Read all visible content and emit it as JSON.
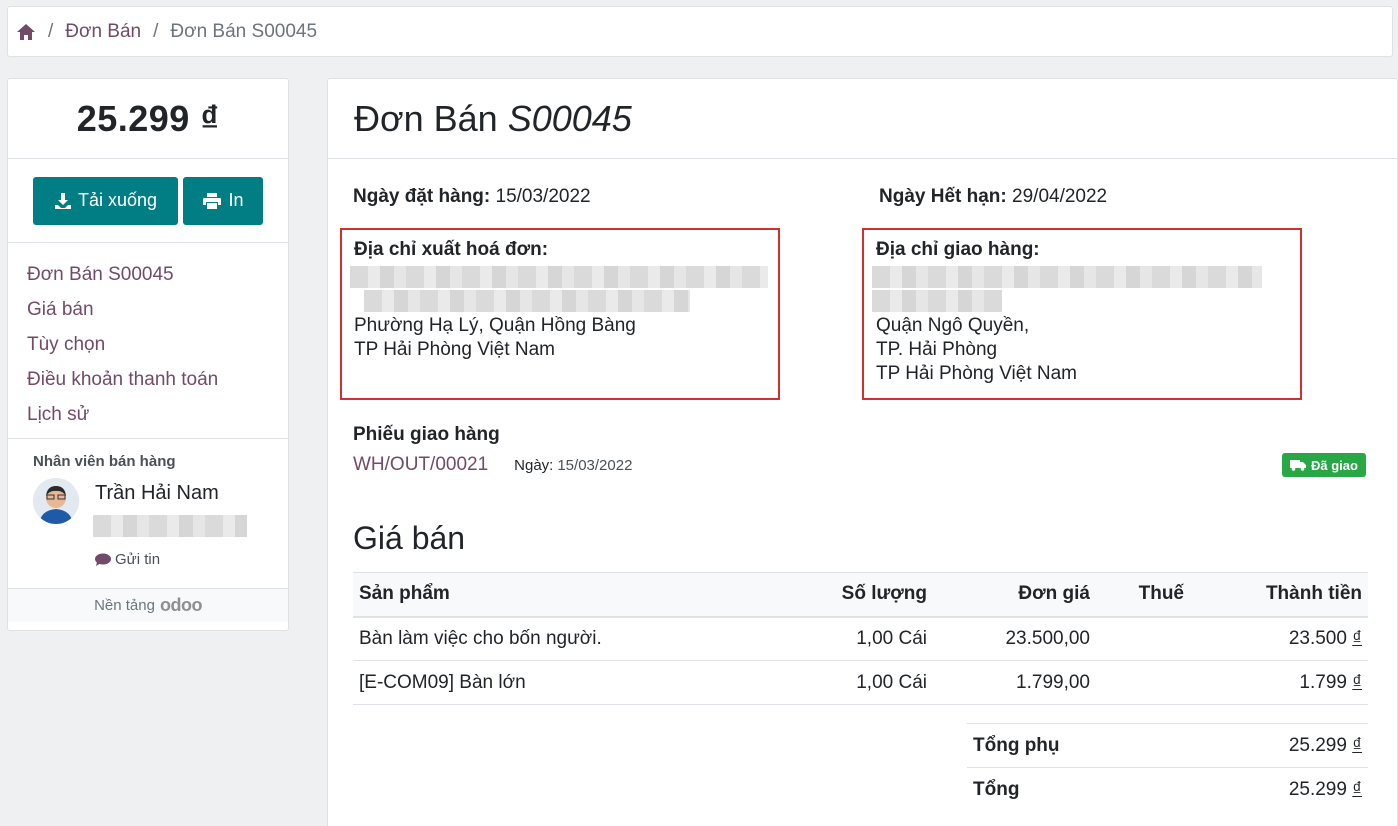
{
  "breadcrumb": {
    "home_icon": "home-icon",
    "sep1": "/",
    "sep2": "/",
    "orders_link": "Đơn Bán",
    "current": "Đơn Bán S00045"
  },
  "sidebar": {
    "amount": "25.299 ₫",
    "download_label": "Tải xuống",
    "print_label": "In",
    "nav": [
      {
        "label": "Đơn Bán S00045"
      },
      {
        "label": "Giá bán"
      },
      {
        "label": "Tùy chọn"
      },
      {
        "label": "Điều khoản thanh toán"
      },
      {
        "label": "Lịch sử"
      }
    ],
    "salesperson_label": "Nhân viên bán hàng",
    "salesperson_name": "Trần Hải Nam",
    "send_message": "Gửi tin",
    "powered_by": "Nền tảng",
    "powered_logo": "odoo"
  },
  "main": {
    "title_prefix": "Đơn Bán",
    "title_ref": "S00045",
    "order_date_label": "Ngày đặt hàng:",
    "order_date": "15/03/2022",
    "expiry_label": "Ngày Hết hạn:",
    "expiry_date": "29/04/2022",
    "invoice_address": {
      "label": "Địa chỉ xuất hoá đơn:",
      "lines": [
        "Phường Hạ Lý, Quận Hồng Bàng",
        "TP Hải Phòng Việt Nam"
      ]
    },
    "shipping_address": {
      "label": "Địa chỉ giao hàng:",
      "lines": [
        "Quận Ngô Quyền,",
        "TP. Hải Phòng",
        "TP Hải Phòng Việt Nam"
      ]
    },
    "delivery": {
      "title": "Phiếu giao hàng",
      "ref": "WH/OUT/00021",
      "date_label": "Ngày:",
      "date": "15/03/2022",
      "status": "Đã giao"
    },
    "pricing_title": "Giá bán",
    "table": {
      "headers": {
        "product": "Sản phẩm",
        "qty": "Số lượng",
        "unit_price": "Đơn giá",
        "tax": "Thuế",
        "subtotal": "Thành tiền"
      },
      "rows": [
        {
          "product": "Bàn làm việc cho bốn người.",
          "qty": "1,00 Cái",
          "unit_price": "23.500,00",
          "tax": "",
          "subtotal": "23.500",
          "currency": "₫"
        },
        {
          "product": "[E-COM09] Bàn lớn",
          "qty": "1,00 Cái",
          "unit_price": "1.799,00",
          "tax": "",
          "subtotal": "1.799",
          "currency": "₫"
        }
      ]
    },
    "totals": {
      "subtotal_label": "Tổng phụ",
      "subtotal": "25.299",
      "total_label": "Tổng",
      "total": "25.299",
      "currency": "₫"
    }
  },
  "colors": {
    "accent": "#017e84",
    "link": "#714b67",
    "success": "#28a745",
    "highlight": "#d32f2f"
  }
}
